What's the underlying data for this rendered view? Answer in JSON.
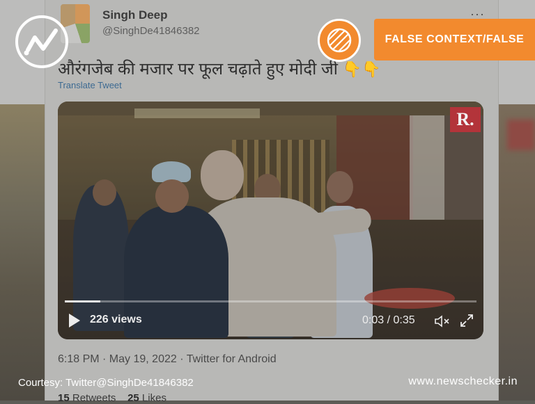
{
  "tweet": {
    "display_name": "Singh Deep",
    "handle": "@SinghDe41846382",
    "text": "औरंगजेब की मजार पर फूल चढ़ाते हुए मोदी जी",
    "emoji": "👇👇",
    "translate_label": "Translate Tweet",
    "more_label": "···",
    "meta": "6:18 PM · May 19, 2022 · Twitter for Android",
    "stats": {
      "retweets": "15",
      "retweets_label": "Retweets",
      "likes": "25",
      "likes_label": "Likes"
    }
  },
  "video": {
    "badge": "R.",
    "views": "226 views",
    "time": "0:03 / 0:35",
    "progress": 0.086,
    "icons": {
      "play": "play-icon",
      "mute": "mute-icon",
      "fullscreen": "fullscreen-icon"
    }
  },
  "overlay": {
    "rating_label": "FALSE CONTEXT/FALSE",
    "courtesy": "Courtesy: Twitter@SinghDe41846382",
    "site": "www.newschecker.in",
    "accent_color": "#f28a2e",
    "logo_icon": "newschecker-logo-icon",
    "rating_icon": "striped-circle-icon"
  }
}
